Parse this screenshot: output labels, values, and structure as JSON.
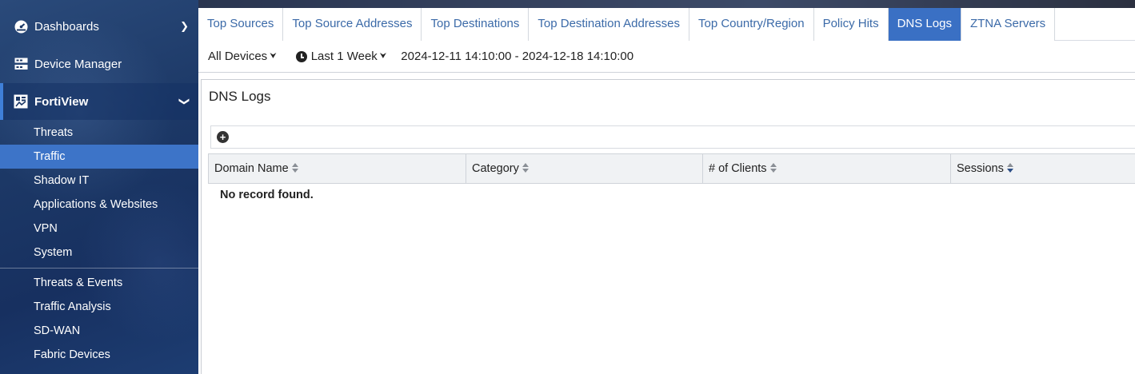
{
  "sidebar": {
    "dashboards_label": "Dashboards",
    "device_manager_label": "Device Manager",
    "fortiview_label": "FortiView",
    "items": [
      {
        "label": "Threats"
      },
      {
        "label": "Traffic"
      },
      {
        "label": "Shadow IT"
      },
      {
        "label": "Applications & Websites"
      },
      {
        "label": "VPN"
      },
      {
        "label": "System"
      },
      {
        "label": "Threats & Events"
      },
      {
        "label": "Traffic Analysis"
      },
      {
        "label": "SD-WAN"
      },
      {
        "label": "Fabric Devices"
      }
    ],
    "active_item": "Traffic",
    "accent_color": "#3d74c8"
  },
  "tabs": [
    {
      "label": "Top Sources"
    },
    {
      "label": "Top Source Addresses"
    },
    {
      "label": "Top Destinations"
    },
    {
      "label": "Top Destination Addresses"
    },
    {
      "label": "Top Country/Region"
    },
    {
      "label": "Policy Hits"
    },
    {
      "label": "DNS Logs"
    },
    {
      "label": "ZTNA Servers"
    }
  ],
  "active_tab": "DNS Logs",
  "filters": {
    "device": "All Devices",
    "time_period": "Last 1 Week",
    "time_range": "2024-12-11 14:10:00 - 2024-12-18 14:10:00"
  },
  "panel": {
    "title": "DNS Logs",
    "columns": [
      {
        "label": "Domain Name",
        "sort": "none"
      },
      {
        "label": "Category",
        "sort": "none"
      },
      {
        "label": "# of Clients",
        "sort": "none"
      },
      {
        "label": "Sessions",
        "sort": "desc"
      }
    ],
    "empty_message": "No record found."
  },
  "icons": {
    "dashboards": "dashboard-icon",
    "device_manager": "device-manager-icon",
    "fortiview": "fortiview-icon",
    "add": "add-circle-icon",
    "clock": "clock-icon"
  }
}
